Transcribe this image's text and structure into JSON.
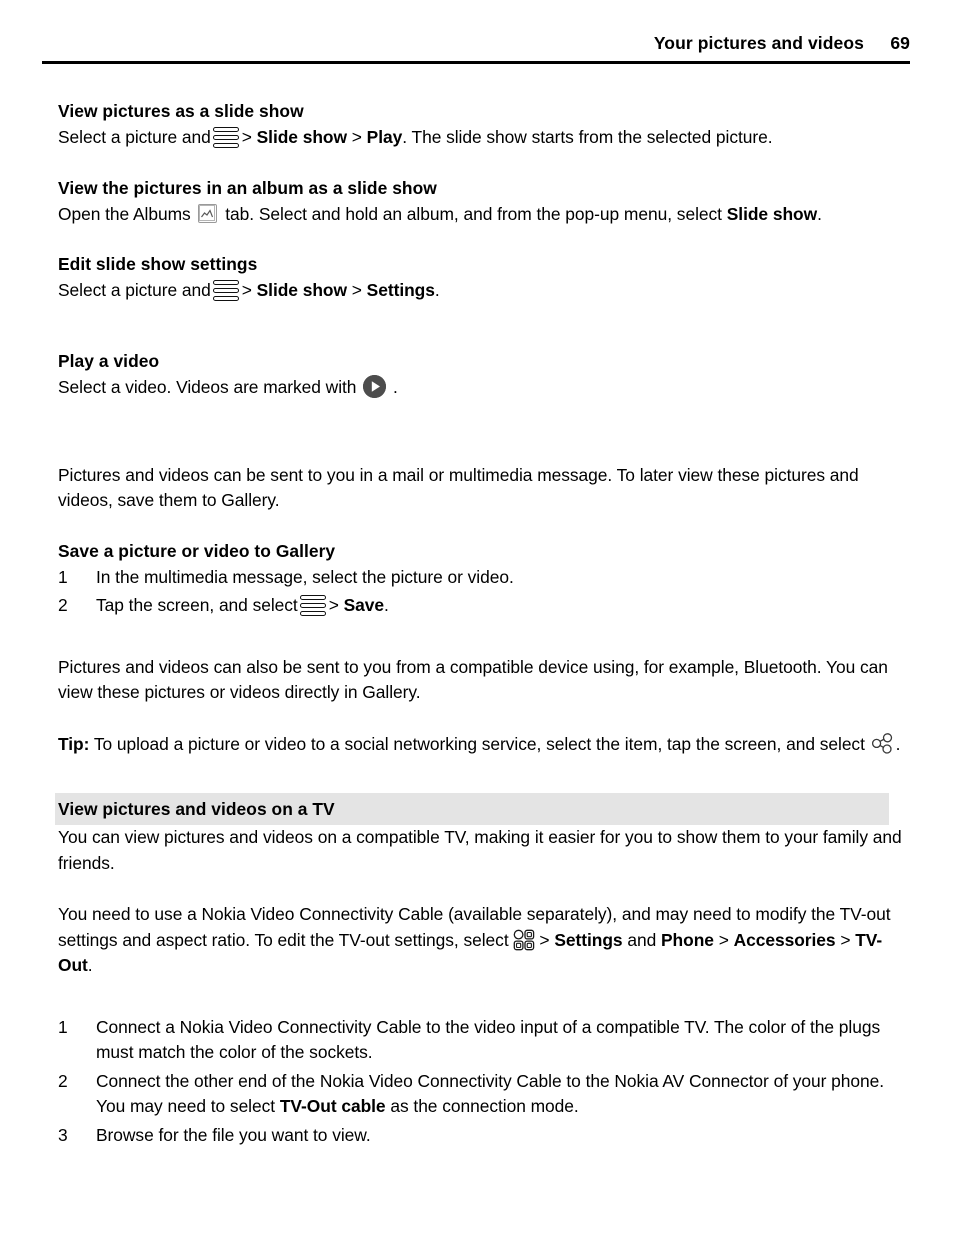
{
  "header": {
    "title": "Your pictures and videos",
    "page_number": "69"
  },
  "sections": [
    {
      "heading": "View pictures as a slide show",
      "body_parts": {
        "p1": "Select a picture and",
        "p2": ">",
        "p3": "Slide show",
        "p4": ">",
        "p5": "Play",
        "p6": ". The slide show starts from the selected picture."
      }
    },
    {
      "heading": "View the pictures in an album as a slide show",
      "body_parts": {
        "p1": "Open the Albums",
        "p2": "tab. Select and hold an album, and from the pop-up menu, select",
        "p3": "Slide show",
        "p4": "."
      }
    },
    {
      "heading": "Edit slide show settings",
      "body_parts": {
        "p1": "Select a picture and",
        "p2": ">",
        "p3": "Slide show",
        "p4": ">",
        "p5": "Settings",
        "p6": "."
      }
    },
    {
      "heading": "Play a video",
      "body_parts": {
        "p1": "Select a video. Videos are marked with",
        "p2": "."
      }
    }
  ],
  "paragraph_gallery": "Pictures and videos can be sent to you in a mail or multimedia message. To later view these pictures and videos, save them to Gallery.",
  "save_section": {
    "heading": "Save a picture or video to Gallery",
    "items": [
      {
        "marker": "1",
        "text": "In the multimedia message, select the picture or video."
      },
      {
        "marker": "2",
        "text_before": "Tap the screen, and select",
        "text_gt": ">",
        "text_bold": "Save",
        "text_after": "."
      }
    ]
  },
  "paragraph_bluetooth": "Pictures and videos can also be sent to you from a compatible device using, for example, Bluetooth. You can view these pictures or videos directly in Gallery.",
  "tip": {
    "label": "Tip:",
    "text_before": "To upload a picture or video to a social networking service, select the item, tap the screen, and select",
    "text_after": "."
  },
  "tv_section": {
    "heading": "View pictures and videos on a TV",
    "intro": "You can view pictures and videos on a compatible TV, making it easier for you to show them to your family and friends.",
    "cable_paragraph": {
      "line1": "You need to use a Nokia Video Connectivity Cable (available separately), and may need to modify the TV-out settings and aspect ratio. To edit the TV-out settings, select",
      "gt1": ">",
      "b1": "Settings",
      "mid1": "and",
      "b2": "Phone",
      "gt2": ">",
      "b3": "Accessories",
      "gt3": ">",
      "b4": "TV-Out",
      "end": "."
    },
    "items": [
      {
        "marker": "1",
        "text": "Connect a Nokia Video Connectivity Cable to the video input of a compatible TV. The color of the plugs must match the color of the sockets."
      },
      {
        "marker": "2",
        "text_before": "Connect the other end of the Nokia Video Connectivity Cable to the Nokia AV Connector of your phone. You may need to select",
        "text_bold": "TV-Out cable",
        "text_after": "as the connection mode."
      },
      {
        "marker": "3",
        "text": "Browse for the file you want to view."
      }
    ]
  },
  "icons": {
    "options": "options-menu-icon",
    "album": "album-tab-icon",
    "play": "play-badge-icon",
    "share": "share-icon",
    "menu_key": "menu-key-icon"
  },
  "colors": {
    "section_heading_bg": "#e4e4e4",
    "play_badge": "#4d4d4d",
    "text": "#000000"
  }
}
